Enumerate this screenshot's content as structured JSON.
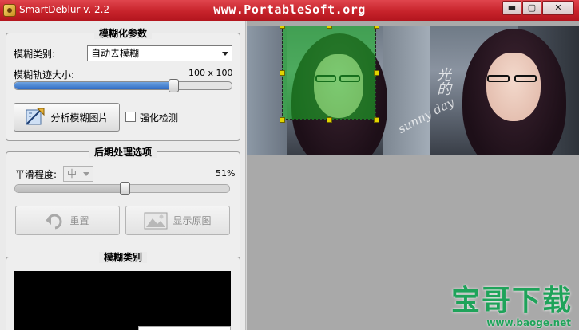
{
  "window": {
    "title": "SmartDeblur v. 2.2",
    "watermark_url": "www.PortableSoft.org",
    "minimize_label": "▬",
    "maximize_label": "▢",
    "close_label": "✕"
  },
  "blur_params": {
    "group_title": "模糊化参数",
    "type_label": "模糊类别:",
    "type_value": "自动去模糊",
    "size_label": "模糊轨迹大小:",
    "size_value": "100 x 100",
    "size_slider_fraction": 0.73,
    "analyze_button": "分析模糊图片",
    "enhance_checkbox_label": "强化检测",
    "enhance_checked": false
  },
  "post_processing": {
    "group_title": "后期处理选项",
    "smooth_label": "平滑程度:",
    "smooth_value": "中",
    "smooth_percent": "51%",
    "smooth_slider_fraction": 0.51,
    "reset_button": "重置",
    "show_original_button": "显示原图"
  },
  "blur_type_panel": {
    "group_title": "模糊类别"
  },
  "image_overlay": {
    "watermark_brand": "宝哥下载",
    "watermark_url": "www.baoge.net",
    "photo_text_1": "sunny day",
    "photo_text_2": "光的"
  },
  "colors": {
    "titlebar": "#c7232b",
    "selection": "#1cbe28",
    "handle": "#e2d400",
    "slider_fill": "#2f6cc4",
    "brand": "#1fa35a"
  }
}
